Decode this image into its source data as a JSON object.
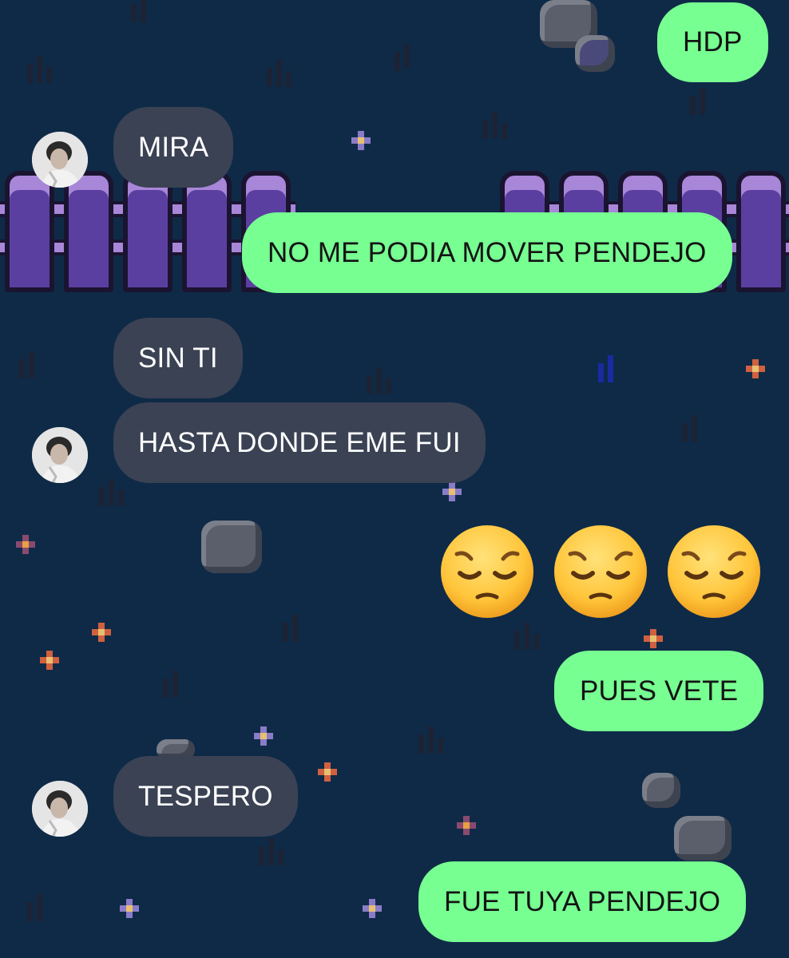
{
  "colors": {
    "background": "#0f2a47",
    "outgoing_bubble": "#77ff92",
    "incoming_bubble": "#3a4254",
    "outgoing_text": "#141414",
    "incoming_text": "#ffffff"
  },
  "messages": [
    {
      "sender": "me",
      "text": "HDP"
    },
    {
      "sender": "them",
      "text": "MIRA",
      "avatar": true
    },
    {
      "sender": "me",
      "text": "NO ME PODIA MOVER PENDEJO"
    },
    {
      "sender": "them",
      "text": "SIN TI"
    },
    {
      "sender": "them",
      "text": "HASTA DONDE EME FUI",
      "avatar": true
    },
    {
      "sender": "me",
      "type": "emoji",
      "emoji": [
        "pensive-face",
        "pensive-face",
        "pensive-face"
      ]
    },
    {
      "sender": "me",
      "text": "PUES VETE"
    },
    {
      "sender": "them",
      "text": "TESPERO",
      "avatar": true
    },
    {
      "sender": "me",
      "text": "FUE TUYA PENDEJO"
    }
  ]
}
